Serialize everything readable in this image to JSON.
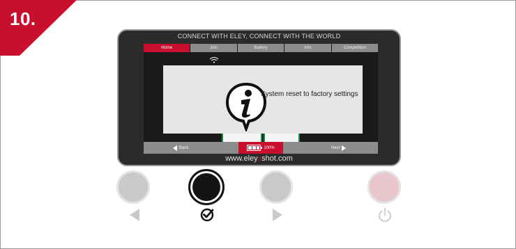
{
  "step": {
    "number": "10.",
    "badge_color": "#c8102e"
  },
  "device": {
    "tagline": "CONNECT WITH ELEY, CONNECT WITH THE WORLD",
    "url_prefix": "www.eley",
    "url_mid": "x",
    "url_suffix": "shot.com",
    "accent_color": "#c8102e"
  },
  "screen": {
    "tabs": [
      {
        "label": "Home",
        "active": true
      },
      {
        "label": "Join",
        "active": false
      },
      {
        "label": "Battery",
        "active": false
      },
      {
        "label": "Info",
        "active": false
      },
      {
        "label": "Competition",
        "active": false
      }
    ],
    "popup": {
      "icon": "info-icon",
      "message": "System reset to factory settings"
    },
    "status_bar": {
      "back_label": "Back",
      "next_label": "Next",
      "battery_percent": "100%",
      "battery_level": 1.0
    }
  },
  "hardware_buttons": [
    {
      "name": "left-button",
      "glyph": "triangle-left-icon"
    },
    {
      "name": "confirm-button",
      "glyph": "checkmark-icon",
      "highlighted": true
    },
    {
      "name": "right-button",
      "glyph": "triangle-right-icon"
    },
    {
      "name": "power-button",
      "glyph": "power-icon"
    }
  ]
}
